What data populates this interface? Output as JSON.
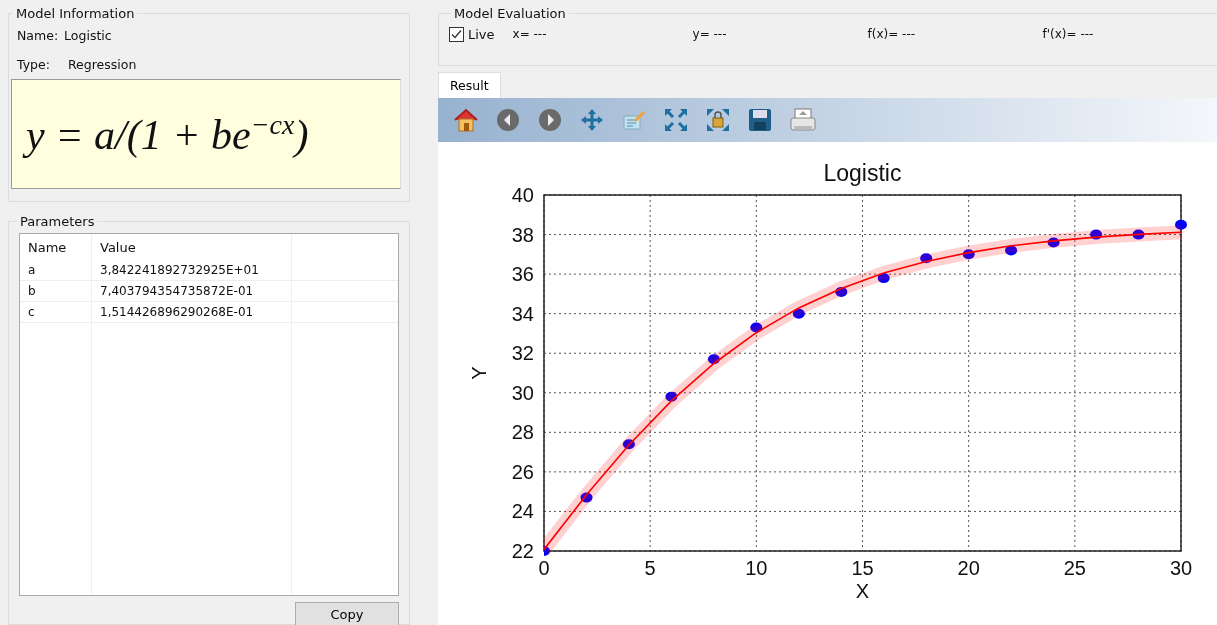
{
  "model_information": {
    "title": "Model Information",
    "name_label": "Name:",
    "name_value": "Logistic",
    "type_label": "Type:",
    "type_value": "Regression",
    "equation": "y = a/(1 + be$^{−cx}$)"
  },
  "parameters": {
    "title": "Parameters",
    "columns": [
      "Name",
      "Value"
    ],
    "rows": [
      {
        "name": "a",
        "value": "3,842241892732925E+01"
      },
      {
        "name": "b",
        "value": "7,403794354735872E-01"
      },
      {
        "name": "c",
        "value": "1,514426896290268E-01"
      }
    ],
    "copy_button": "Copy"
  },
  "model_evaluation": {
    "title": "Model Evaluation",
    "live": {
      "label": "Live",
      "checked": true
    },
    "readouts": [
      "x= ---",
      "y= ---",
      "f(x)= ---",
      "f'(x)= ---"
    ]
  },
  "tabs": [
    {
      "label": "Result",
      "selected": true
    }
  ],
  "toolbar": [
    {
      "kind": "home"
    },
    {
      "kind": "back"
    },
    {
      "kind": "forward"
    },
    {
      "kind": "pan"
    },
    {
      "kind": "edit"
    },
    {
      "kind": "fit"
    },
    {
      "kind": "zoom"
    },
    {
      "kind": "save"
    },
    {
      "kind": "print"
    }
  ],
  "chart_data": {
    "type": "scatter",
    "title": "Logistic",
    "xlabel": "X",
    "ylabel": "Y",
    "xlim": [
      0,
      30
    ],
    "ylim": [
      22,
      40
    ],
    "xticks": [
      0,
      5,
      10,
      15,
      20,
      25,
      30
    ],
    "yticks": [
      22,
      24,
      26,
      28,
      30,
      32,
      34,
      36,
      38,
      40
    ],
    "x": [
      0,
      2,
      4,
      6,
      8,
      10,
      12,
      14,
      16,
      18,
      20,
      22,
      24,
      26,
      28,
      30
    ],
    "grid": true,
    "series": [
      {
        "color": "#0000ff",
        "values": [
          22.0,
          24.7,
          27.4,
          29.8,
          31.7,
          33.3,
          34.0,
          35.1,
          35.8,
          36.8,
          37.0,
          37.2,
          37.6,
          38.0,
          38.0,
          38.5
        ]
      },
      {
        "type": "line",
        "color": "#ff0000",
        "values": [
          22.08,
          24.84,
          27.36,
          29.59,
          31.48,
          33.04,
          34.29,
          35.28,
          36.05,
          36.64,
          37.09,
          37.43,
          37.68,
          37.87,
          38.01,
          38.12
        ]
      }
    ]
  }
}
